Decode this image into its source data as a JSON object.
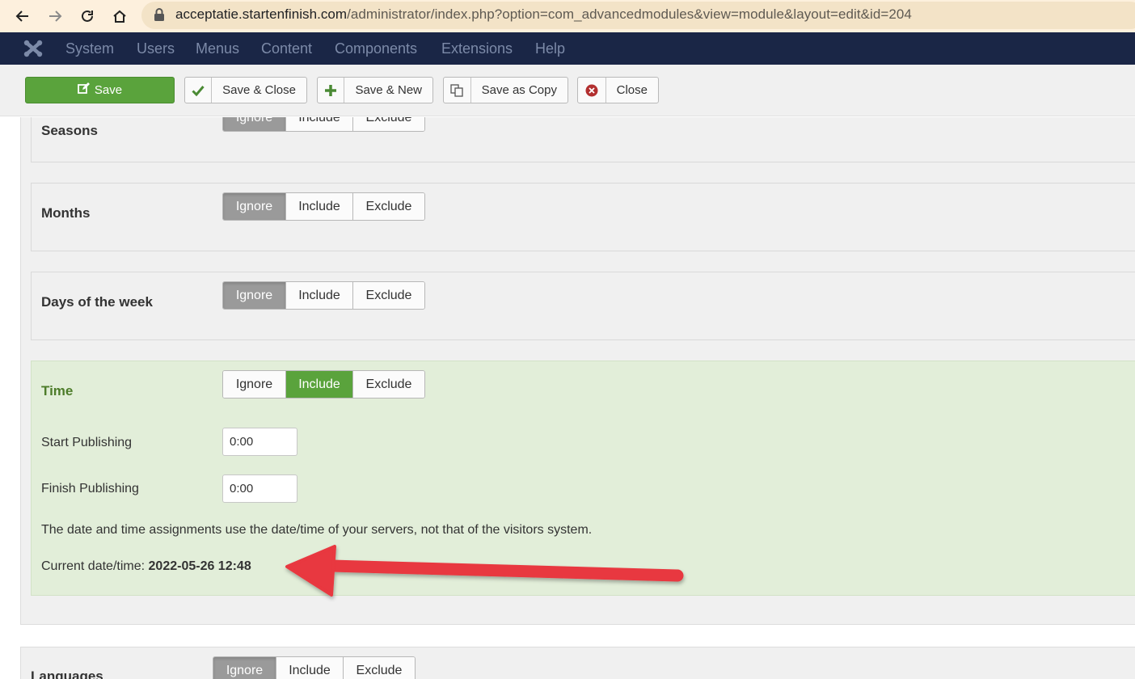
{
  "browser": {
    "url_host": "acceptatie.startenfinish.com",
    "url_path": "/administrator/index.php?option=com_advancedmodules&view=module&layout=edit&id=204"
  },
  "nav": {
    "items": [
      "System",
      "Users",
      "Menus",
      "Content",
      "Components",
      "Extensions",
      "Help"
    ]
  },
  "toolbar": {
    "save": "Save",
    "save_close": "Save & Close",
    "save_new": "Save & New",
    "save_copy": "Save as Copy",
    "close": "Close"
  },
  "options": {
    "ignore": "Ignore",
    "include": "Include",
    "exclude": "Exclude"
  },
  "sections": {
    "seasons": {
      "label": "Seasons",
      "selected": "Ignore"
    },
    "months": {
      "label": "Months",
      "selected": "Ignore"
    },
    "days": {
      "label": "Days of the week",
      "selected": "Ignore"
    },
    "time": {
      "label": "Time",
      "selected": "Include",
      "start_label": "Start Publishing",
      "start_value": "0:00",
      "finish_label": "Finish Publishing",
      "finish_value": "0:00",
      "note": "The date and time assignments use the date/time of your servers, not that of the visitors system.",
      "current_label": "Current date/time:",
      "current_value": "2022-05-26 12:48"
    },
    "languages": {
      "label": "Languages",
      "selected": "Ignore"
    }
  },
  "colors": {
    "accent_green": "#5aa33c",
    "nav_bg": "#1a2646",
    "annotation_arrow": "#e8373f"
  }
}
